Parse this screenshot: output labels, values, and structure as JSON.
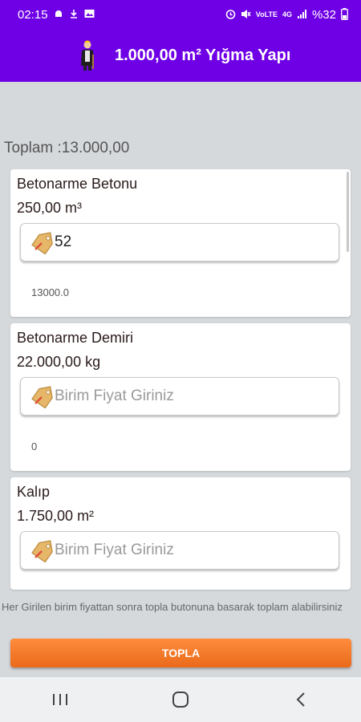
{
  "status_bar": {
    "time": "02:15",
    "battery": "%32",
    "left_icons": [
      "android-icon",
      "download-icon",
      "gallery-icon"
    ],
    "right_icons": [
      "alarm-icon",
      "mute-icon",
      "volte-icon",
      "4g-icon",
      "signal-icon",
      "battery-icon"
    ]
  },
  "app_bar": {
    "title": "1.000,00 m² Yığma Yapı",
    "background": "#6f00e6"
  },
  "total": {
    "label": "Toplam :13.000,00"
  },
  "items": [
    {
      "name": "Betonarme Betonu",
      "quantity": "250,00 m³",
      "input_value": "52",
      "placeholder": "Birim Fiyat Giriniz",
      "result": "13000.0"
    },
    {
      "name": "Betonarme Demiri",
      "quantity": "22.000,00 kg",
      "input_value": "",
      "placeholder": "Birim Fiyat Giriniz",
      "result": "0"
    },
    {
      "name": "Kalıp",
      "quantity": "1.750,00 m²",
      "input_value": "",
      "placeholder": "Birim Fiyat Giriniz",
      "result": ""
    }
  ],
  "hint": "Her Girilen birim fiyattan sonra topla butonuna basarak toplam alabilirsiniz",
  "button": {
    "label": "TOPLA",
    "color": "#f07a2a"
  },
  "nav": [
    "recents-icon",
    "home-icon",
    "back-icon"
  ]
}
